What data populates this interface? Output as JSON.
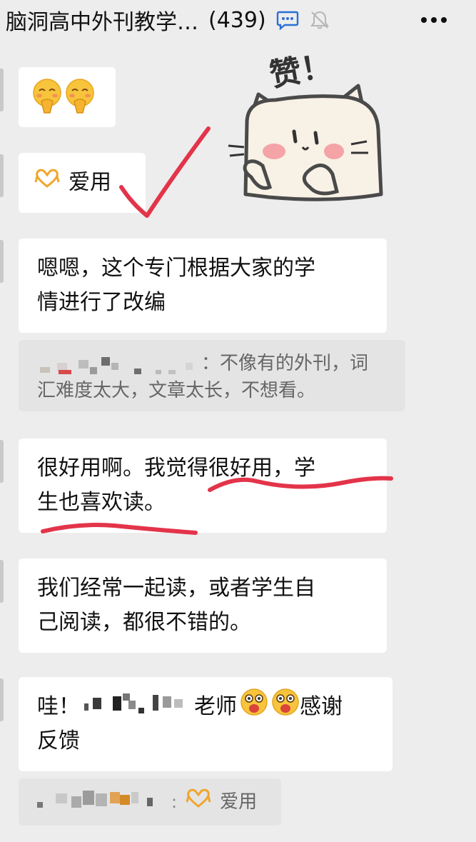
{
  "header": {
    "title": "脑洞高中外刊教学…",
    "count": "(439)",
    "more_icon": "more-dots-icon",
    "mute_icon": "bell-muted-icon",
    "chat_icon": "chat-bubble-icon"
  },
  "messages": [
    {
      "kind": "emoji",
      "emojis": [
        "🙏",
        "🙏"
      ]
    },
    {
      "kind": "text",
      "text": "爱用",
      "icon": "heart-hands-icon"
    },
    {
      "kind": "text",
      "lines": [
        "嗯嗯，这个专门根据大家的学",
        "情进行了改编"
      ]
    },
    {
      "kind": "quote",
      "lines": [
        "：不像有的外刊，词",
        "汇难度太大，文章太长，不想看。"
      ]
    },
    {
      "kind": "text",
      "lines": [
        "很好用啊。我觉得很好用，学",
        "生也喜欢读。"
      ]
    },
    {
      "kind": "text",
      "lines": [
        "我们经常一起读，或者学生自",
        "己阅读，都很不错的。"
      ]
    },
    {
      "kind": "text",
      "parts": {
        "prefix": "哇！",
        "middle": "老师",
        "suffix": "感谢"
      },
      "line2": "反馈"
    },
    {
      "kind": "quote",
      "text": "爱用",
      "icon": "heart-hands-icon"
    }
  ],
  "sticker": {
    "caption": "赞！"
  },
  "colors": {
    "background": "#ededed",
    "bubble": "#ffffff",
    "quote": "#e4e4e4",
    "annotation_red": "#e3344a"
  }
}
